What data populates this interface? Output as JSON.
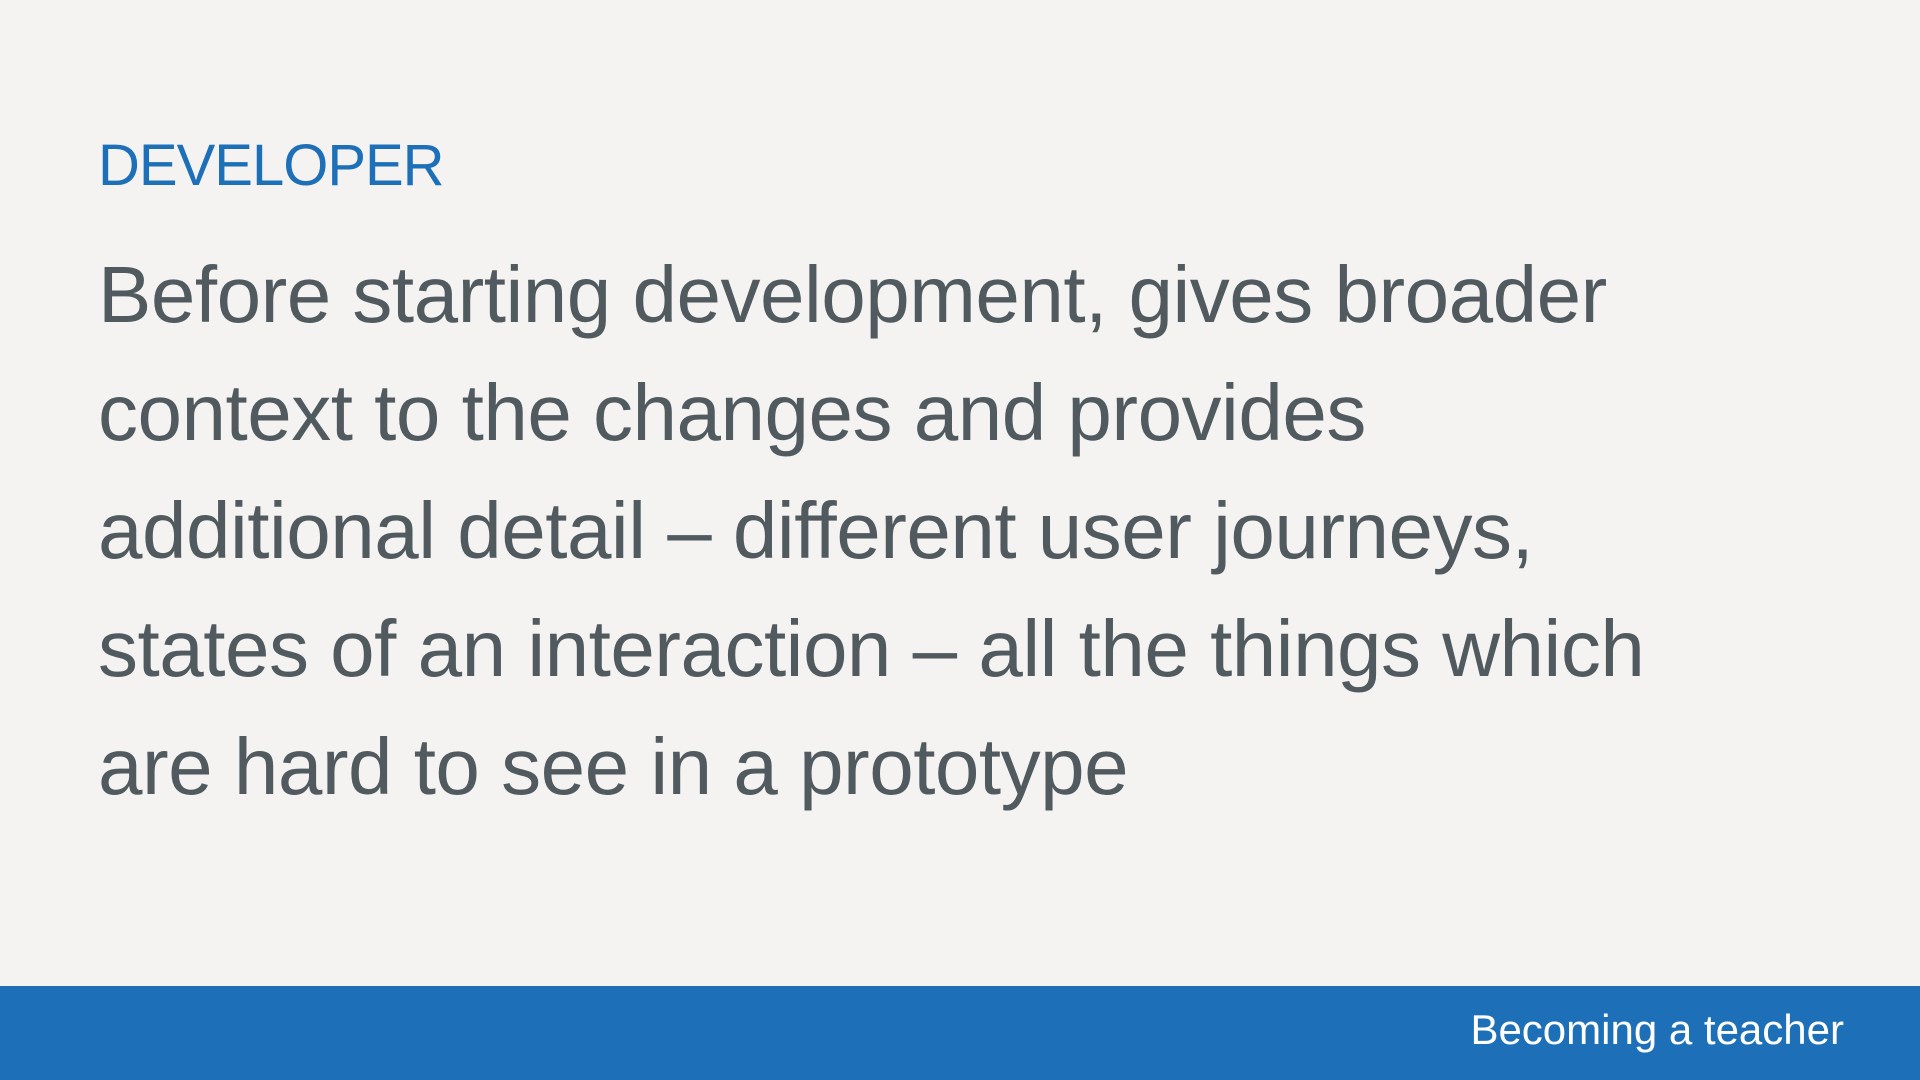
{
  "slide": {
    "eyebrow": "DEVELOPER",
    "body_lines": [
      "Before starting development, gives broader",
      "context to the changes and provides",
      "additional detail – different user journeys,",
      "states of an interaction – all the things which",
      "are hard to see in a prototype"
    ]
  },
  "footer": {
    "label": "Becoming a teacher"
  },
  "colors": {
    "background": "#f4f3f2",
    "accent_blue": "#1d70b8",
    "body_text": "#505a5f",
    "footer_text": "#ffffff"
  }
}
